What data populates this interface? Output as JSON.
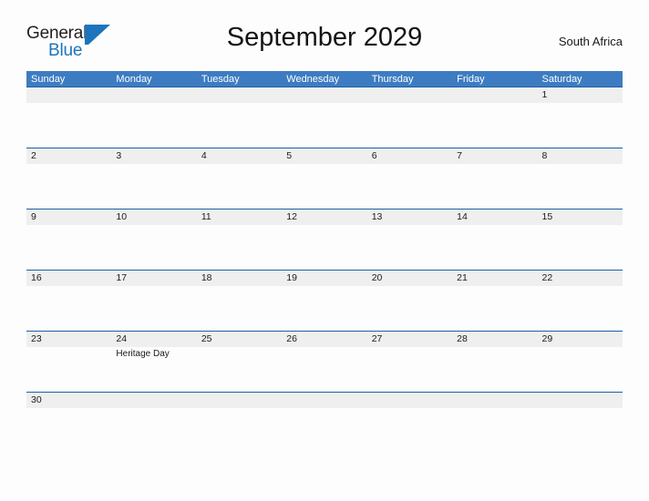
{
  "brand": {
    "name_part1": "General",
    "name_part2": "Blue",
    "mark": "sail-triangle"
  },
  "header": {
    "title": "September 2029",
    "region": "South Africa"
  },
  "colors": {
    "header_blue": "#3d7cc2",
    "rule_blue": "#1b5fa6",
    "band_gray": "#efefef",
    "brand_blue": "#1c75bc",
    "text": "#1a1a1a",
    "page_bg": "#fdfdfd"
  },
  "calendar": {
    "day_headers": [
      "Sunday",
      "Monday",
      "Tuesday",
      "Wednesday",
      "Thursday",
      "Friday",
      "Saturday"
    ],
    "weeks": [
      {
        "days": [
          {
            "num": "",
            "event": ""
          },
          {
            "num": "",
            "event": ""
          },
          {
            "num": "",
            "event": ""
          },
          {
            "num": "",
            "event": ""
          },
          {
            "num": "",
            "event": ""
          },
          {
            "num": "",
            "event": ""
          },
          {
            "num": "1",
            "event": ""
          }
        ]
      },
      {
        "days": [
          {
            "num": "2",
            "event": ""
          },
          {
            "num": "3",
            "event": ""
          },
          {
            "num": "4",
            "event": ""
          },
          {
            "num": "5",
            "event": ""
          },
          {
            "num": "6",
            "event": ""
          },
          {
            "num": "7",
            "event": ""
          },
          {
            "num": "8",
            "event": ""
          }
        ]
      },
      {
        "days": [
          {
            "num": "9",
            "event": ""
          },
          {
            "num": "10",
            "event": ""
          },
          {
            "num": "11",
            "event": ""
          },
          {
            "num": "12",
            "event": ""
          },
          {
            "num": "13",
            "event": ""
          },
          {
            "num": "14",
            "event": ""
          },
          {
            "num": "15",
            "event": ""
          }
        ]
      },
      {
        "days": [
          {
            "num": "16",
            "event": ""
          },
          {
            "num": "17",
            "event": ""
          },
          {
            "num": "18",
            "event": ""
          },
          {
            "num": "19",
            "event": ""
          },
          {
            "num": "20",
            "event": ""
          },
          {
            "num": "21",
            "event": ""
          },
          {
            "num": "22",
            "event": ""
          }
        ]
      },
      {
        "days": [
          {
            "num": "23",
            "event": ""
          },
          {
            "num": "24",
            "event": "Heritage Day"
          },
          {
            "num": "25",
            "event": ""
          },
          {
            "num": "26",
            "event": ""
          },
          {
            "num": "27",
            "event": ""
          },
          {
            "num": "28",
            "event": ""
          },
          {
            "num": "29",
            "event": ""
          }
        ]
      },
      {
        "days": [
          {
            "num": "30",
            "event": ""
          },
          {
            "num": "",
            "event": ""
          },
          {
            "num": "",
            "event": ""
          },
          {
            "num": "",
            "event": ""
          },
          {
            "num": "",
            "event": ""
          },
          {
            "num": "",
            "event": ""
          },
          {
            "num": "",
            "event": ""
          }
        ]
      }
    ]
  }
}
